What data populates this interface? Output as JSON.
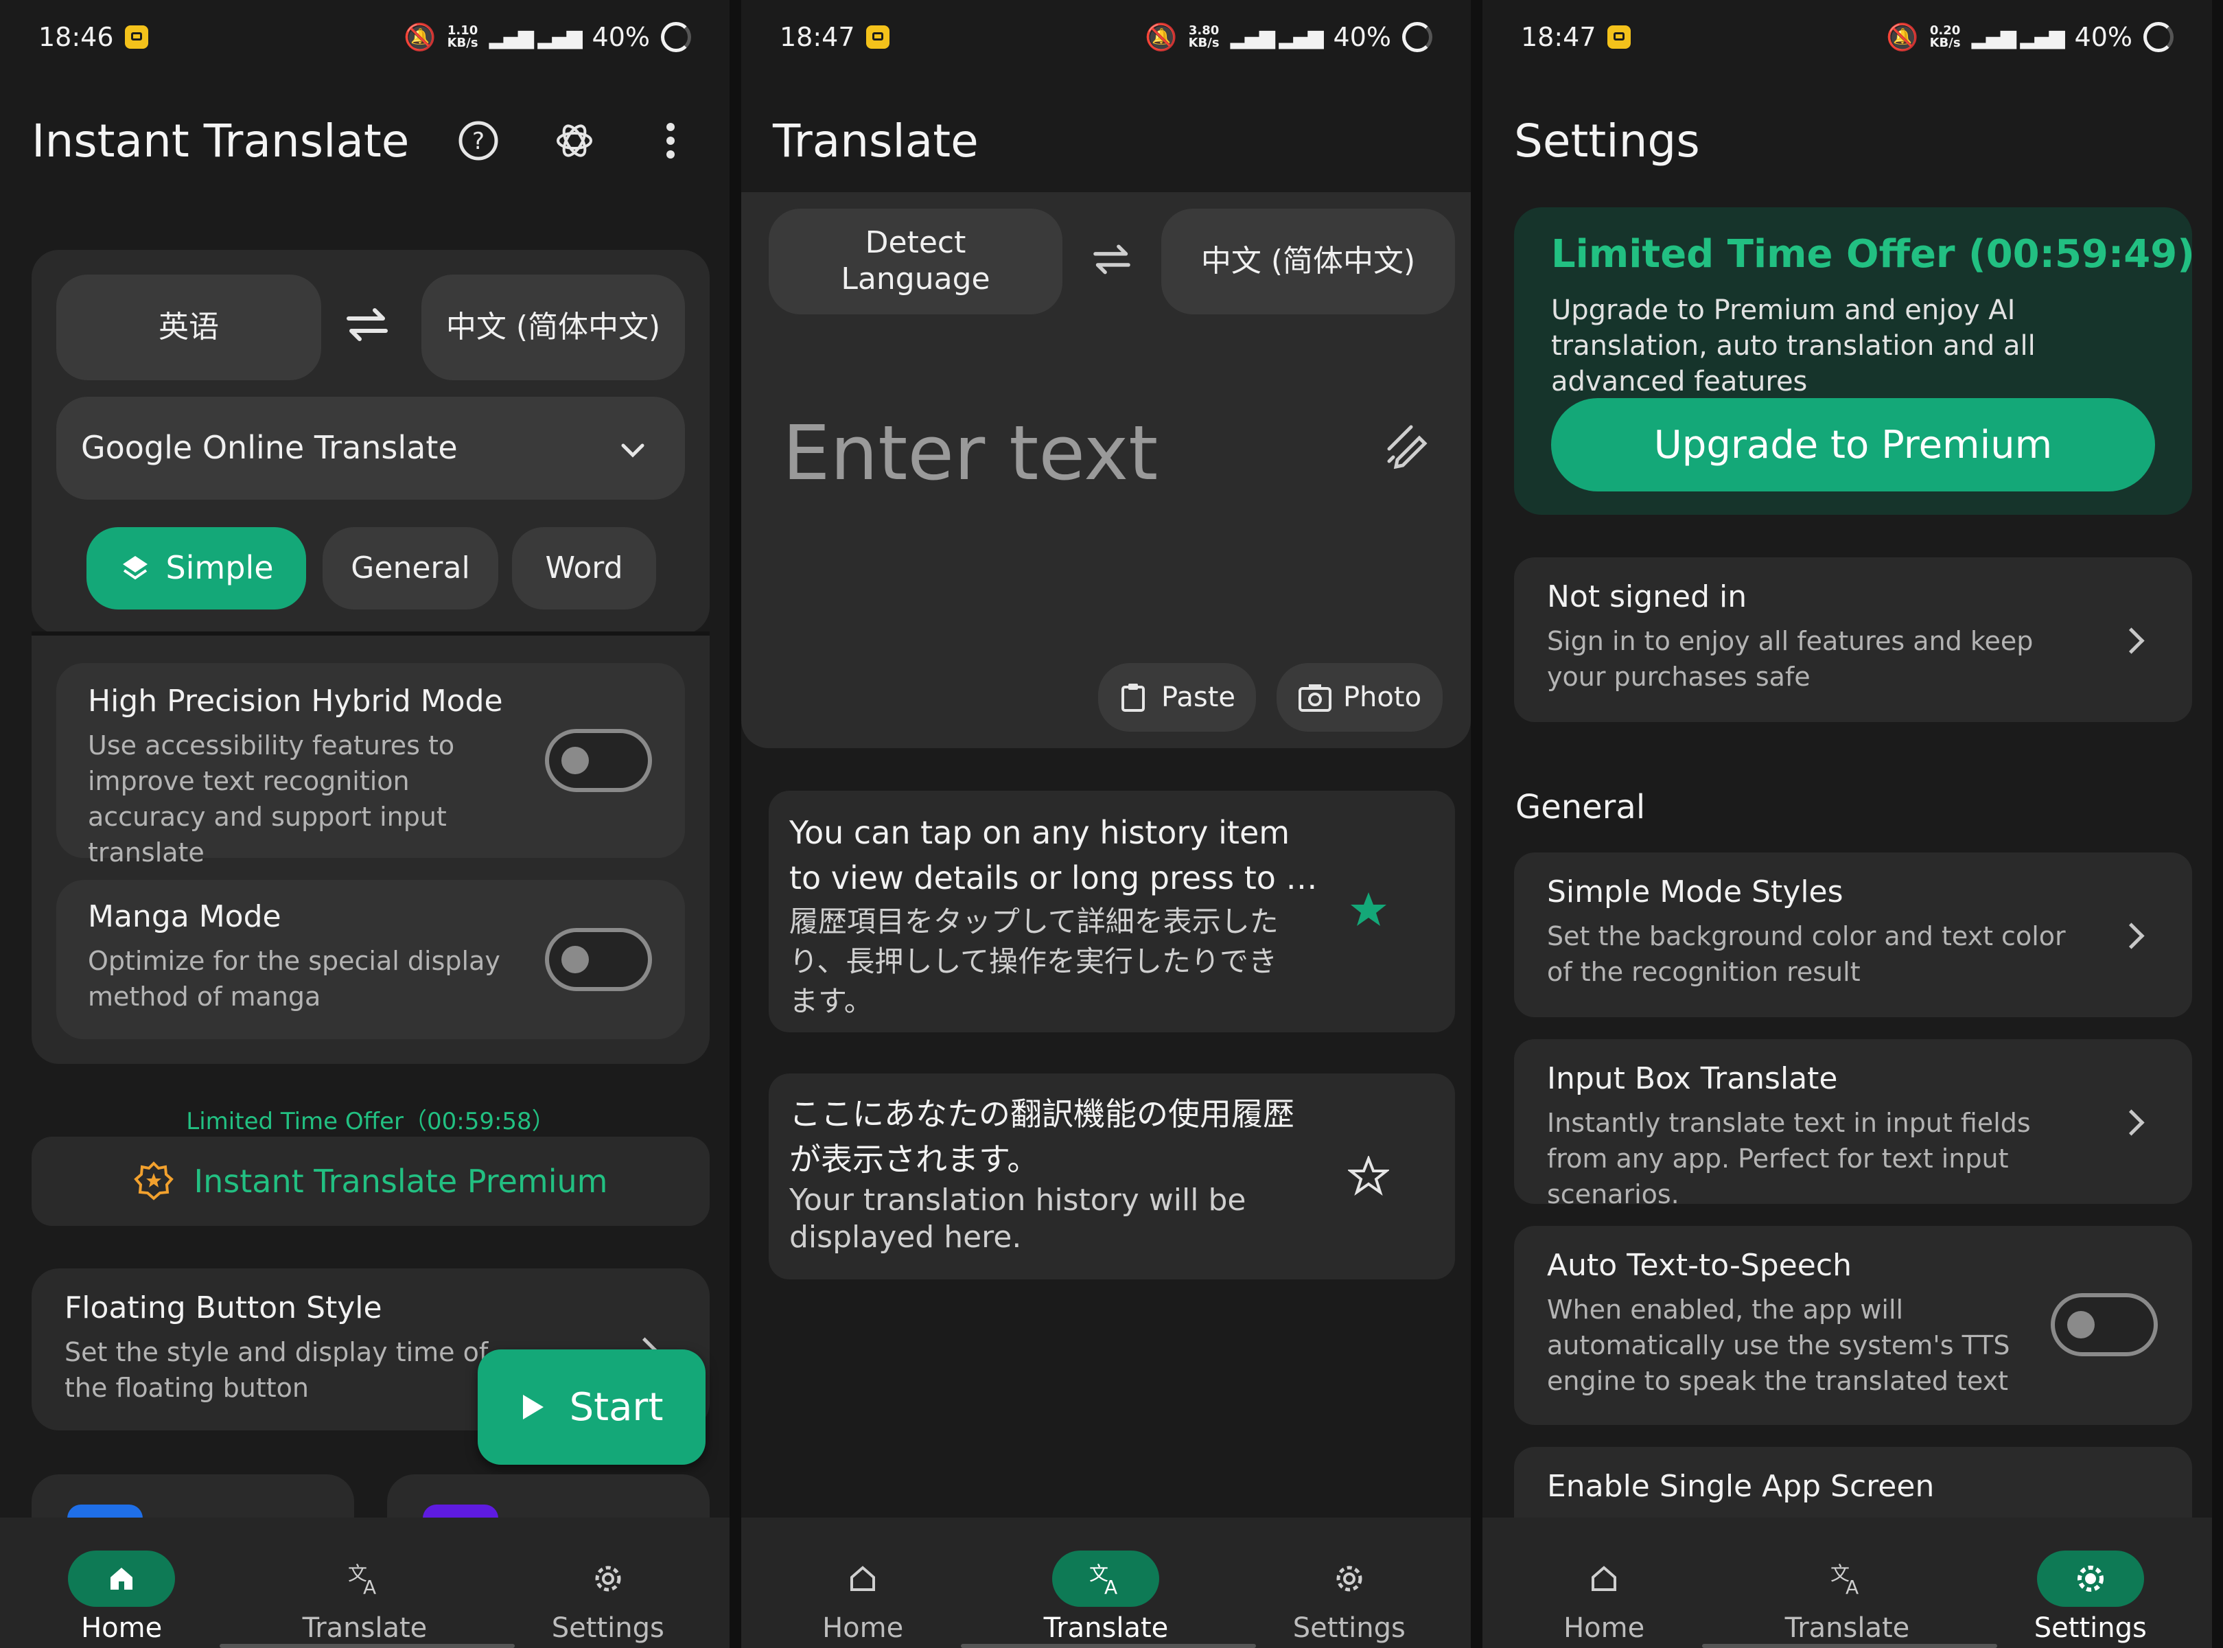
{
  "status": [
    {
      "time": "18:46",
      "speed": "1.10",
      "unit": "KB/s",
      "battery": "40%"
    },
    {
      "time": "18:47",
      "speed": "3.80",
      "unit": "KB/s",
      "battery": "40%"
    },
    {
      "time": "18:47",
      "speed": "0.20",
      "unit": "KB/s",
      "battery": "40%"
    }
  ],
  "home": {
    "title": "Instant Translate",
    "source_lang": "英语",
    "target_lang": "中文 (简体中文)",
    "engine": "Google Online Translate",
    "modes": [
      "Simple",
      "General",
      "Word"
    ],
    "hybrid": {
      "title": "High Precision Hybrid Mode",
      "desc": "Use accessibility features to improve text recognition accuracy and support input translate"
    },
    "manga": {
      "title": "Manga Mode",
      "desc": "Optimize for the special display method of manga"
    },
    "offer_timer": "Limited Time Offer（00:59:58）",
    "premium_label": "Instant Translate Premium",
    "floating": {
      "title": "Floating Button Style",
      "desc": "Set the style and display time of the floating button"
    },
    "start_label": "Start"
  },
  "translate": {
    "title": "Translate",
    "source_lang": "Detect Language",
    "target_lang": "中文 (简体中文)",
    "placeholder": "Enter text",
    "paste_label": "Paste",
    "photo_label": "Photo",
    "history": [
      {
        "src": "You can tap on any history item to view details or long press to …",
        "dst": "履歴項目をタップして詳細を表示したり、長押しして操作を実行したりできます。",
        "starred": true
      },
      {
        "src": "ここにあなたの翻訳機能の使用履歴が表示されます。",
        "dst": "Your translation history will be displayed here.",
        "starred": false
      }
    ]
  },
  "settings": {
    "title": "Settings",
    "offer_title": "Limited Time Offer",
    "offer_timer": "(00:59:49)",
    "offer_desc": "Upgrade to Premium and enjoy AI translation, auto translation and all advanced features",
    "upgrade_label": "Upgrade to Premium",
    "account": {
      "title": "Not signed in",
      "desc": "Sign in to enjoy all features and keep your purchases safe"
    },
    "section_general": "General",
    "items": [
      {
        "title": "Simple Mode Styles",
        "desc": "Set the background color and text color of the recognition result"
      },
      {
        "title": "Input Box Translate",
        "desc": "Instantly translate text in input fields from any app. Perfect for text input scenarios."
      },
      {
        "title": "Auto Text-to-Speech",
        "desc": "When enabled, the app will automatically use the system's TTS engine to speak the translated text"
      },
      {
        "title": "Enable Single App Screen",
        "desc": ""
      }
    ]
  },
  "nav": {
    "home": "Home",
    "translate": "Translate",
    "settings": "Settings"
  },
  "colors": {
    "accent": "#14a878",
    "card": "#2a2a2a",
    "bg": "#1b1b1b"
  }
}
